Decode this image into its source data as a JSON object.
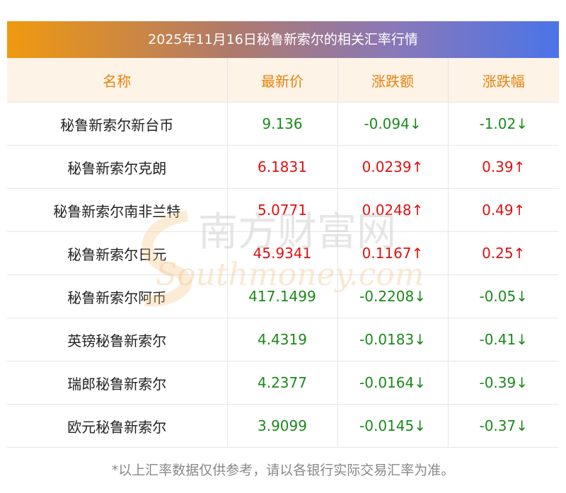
{
  "title": "2025年11月16日秘鲁新索尔的相关汇率行情",
  "headers": [
    "名称",
    "最新价",
    "涨跌额",
    "涨跌幅"
  ],
  "rows": [
    {
      "name": "秘鲁新索尔新台币",
      "price": "9.136",
      "change": "-0.094↓",
      "pct": "-1.02↓",
      "dir": "down"
    },
    {
      "name": "秘鲁新索尔克朗",
      "price": "6.1831",
      "change": "0.0239↑",
      "pct": "0.39↑",
      "dir": "up"
    },
    {
      "name": "秘鲁新索尔南非兰特",
      "price": "5.0771",
      "change": "0.0248↑",
      "pct": "0.49↑",
      "dir": "up"
    },
    {
      "name": "秘鲁新索尔日元",
      "price": "45.9341",
      "change": "0.1167↑",
      "pct": "0.25↑",
      "dir": "up"
    },
    {
      "name": "秘鲁新索尔阿币",
      "price": "417.1499",
      "change": "-0.2208↓",
      "pct": "-0.05↓",
      "dir": "down"
    },
    {
      "name": "英镑秘鲁新索尔",
      "price": "4.4319",
      "change": "-0.0183↓",
      "pct": "-0.41↓",
      "dir": "down"
    },
    {
      "name": "瑞郎秘鲁新索尔",
      "price": "4.2377",
      "change": "-0.0164↓",
      "pct": "-0.39↓",
      "dir": "down"
    },
    {
      "name": "欧元秘鲁新索尔",
      "price": "3.9099",
      "change": "-0.0145↓",
      "pct": "-0.37↓",
      "dir": "down"
    }
  ],
  "footnote": "*以上汇率数据仅供参考，请以各银行实际交易汇率为准。",
  "watermark": {
    "cn": "南方财富网",
    "en": "Southmoney.com"
  },
  "colors": {
    "up": "#e01010",
    "down": "#1a8a1a",
    "header_text": "#e8820c"
  }
}
